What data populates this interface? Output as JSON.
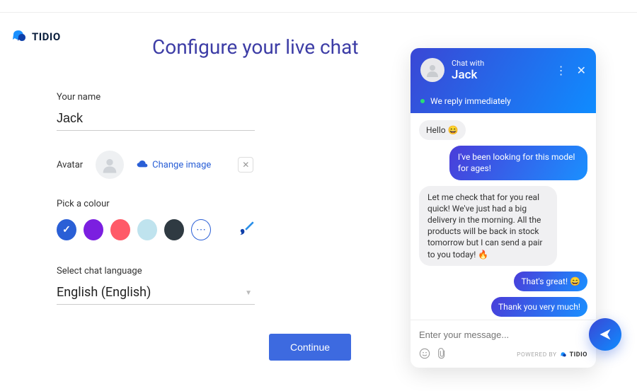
{
  "brand": "TIDIO",
  "page_title": "Configure your live chat",
  "form": {
    "name_label": "Your name",
    "name_value": "Jack",
    "avatar_label": "Avatar",
    "change_image": "Change image",
    "colour_label": "Pick a colour",
    "colours": {
      "blue": "#2a5fd6",
      "purple": "#7b1fe0",
      "coral": "#ff5a68",
      "ice": "#bfe3ee",
      "charcoal": "#2f3a42"
    },
    "selected_colour": "blue",
    "language_label": "Select chat language",
    "language_value": "English (English)",
    "continue": "Continue"
  },
  "preview": {
    "chat_with": "Chat with",
    "operator_name": "Jack",
    "status_text": "We reply immediately",
    "messages": [
      {
        "side": "left",
        "text": "Hello 😄"
      },
      {
        "side": "right",
        "text": "I've been looking for this model for ages!"
      },
      {
        "side": "left",
        "text": "Let me check that for you real quick! We've just had a big delivery in the morning. All the products will be back in stock tomorrow but I can send a pair to you today! 🔥"
      },
      {
        "side": "right",
        "text": "That's great! 😄"
      },
      {
        "side": "right",
        "text": "Thank you very much!"
      }
    ],
    "composer_placeholder": "Enter your message...",
    "powered_by": "POWERED BY",
    "powered_brand": "TIDIO"
  }
}
